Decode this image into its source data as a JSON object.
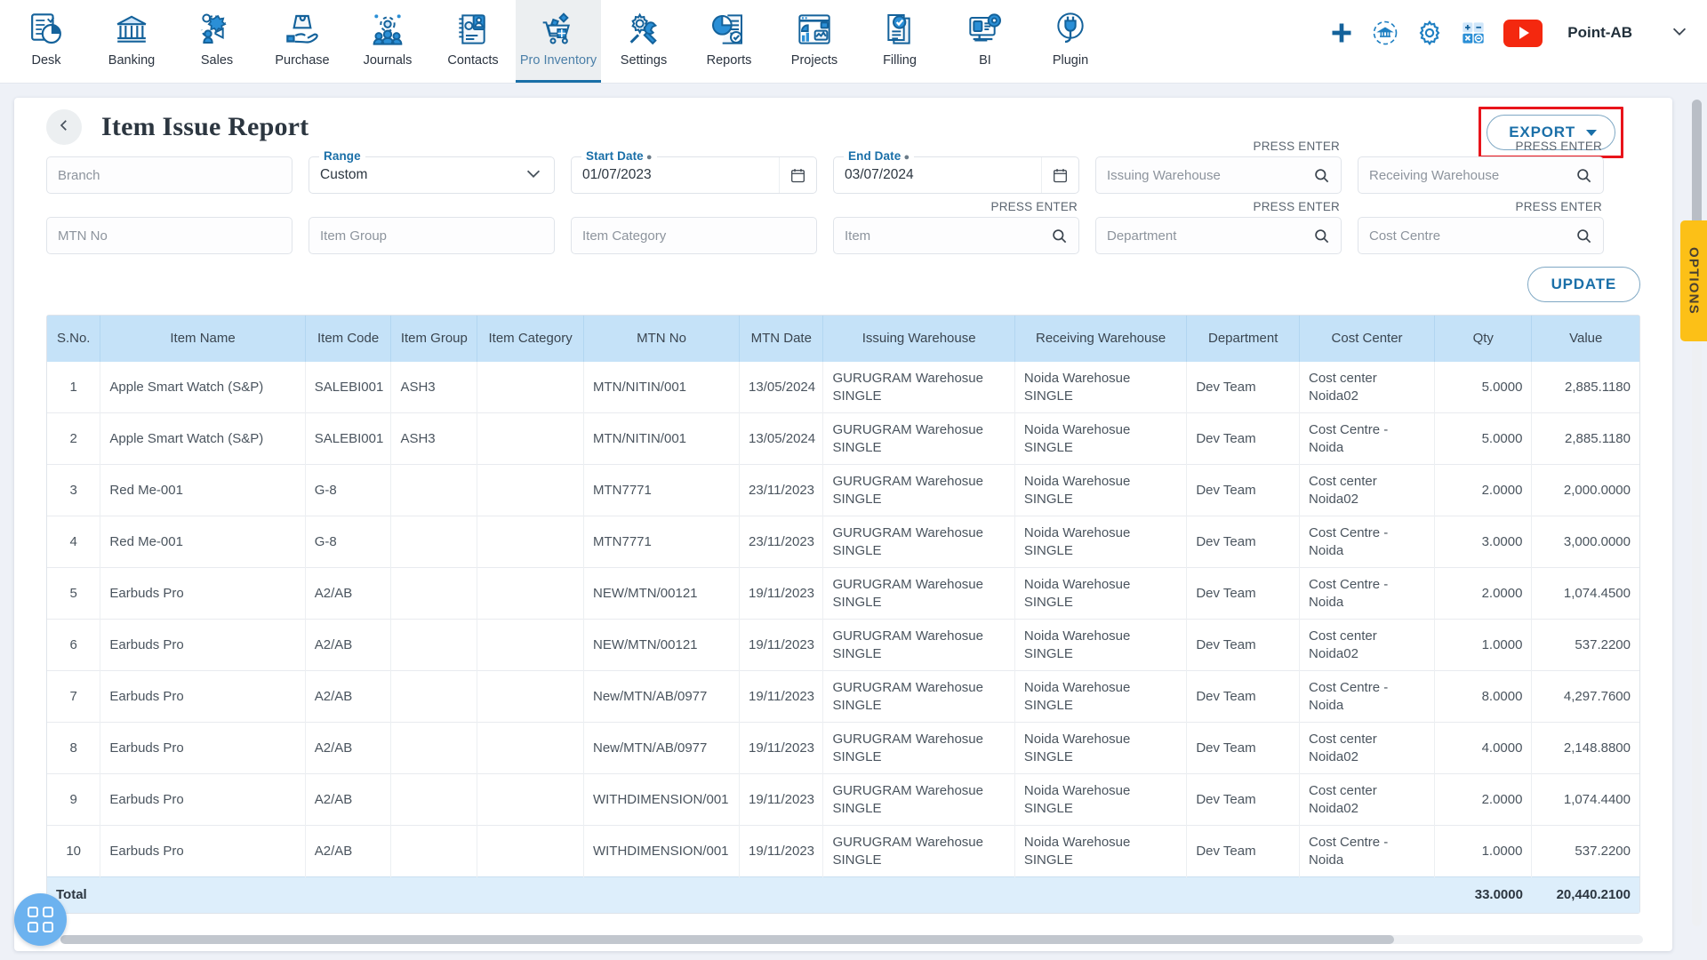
{
  "nav": {
    "items": [
      {
        "label": "Desk",
        "icon": "dashboard-icon",
        "active": false
      },
      {
        "label": "Banking",
        "icon": "bank-icon",
        "active": false
      },
      {
        "label": "Sales",
        "icon": "sales-icon",
        "active": false
      },
      {
        "label": "Purchase",
        "icon": "purchase-icon",
        "active": false
      },
      {
        "label": "Journals",
        "icon": "journals-icon",
        "active": false
      },
      {
        "label": "Contacts",
        "icon": "contacts-icon",
        "active": false
      },
      {
        "label": "Pro Inventory",
        "icon": "inventory-cart-icon",
        "active": true
      },
      {
        "label": "Settings",
        "icon": "settings-tools-icon",
        "active": false
      },
      {
        "label": "Reports",
        "icon": "reports-pie-icon",
        "active": false
      },
      {
        "label": "Projects",
        "icon": "projects-icon",
        "active": false
      },
      {
        "label": "Filling",
        "icon": "filling-check-icon",
        "active": false
      },
      {
        "label": "BI",
        "icon": "bi-monitor-icon",
        "active": false
      },
      {
        "label": "Plugin",
        "icon": "plugin-plug-icon",
        "active": false
      }
    ],
    "right": {
      "add_icon": "plus-icon",
      "sync_icon": "bank-sync-icon",
      "settings_icon": "gear-icon",
      "calculator_icon": "calculator-icon",
      "youtube_icon": "youtube-icon",
      "brand": "Point-AB",
      "chevron_icon": "chevron-down-icon"
    }
  },
  "header": {
    "back_icon": "chevron-left-icon",
    "title": "Item Issue Report",
    "export_label": "EXPORT",
    "export_caret_icon": "caret-down-icon",
    "highlight_color": "#e8141b"
  },
  "filters": {
    "press_enter": "PRESS ENTER",
    "row1": [
      {
        "name": "branch",
        "placeholder": "Branch",
        "value": "",
        "type": "text",
        "label": ""
      },
      {
        "name": "range",
        "placeholder": "",
        "value": "Custom",
        "type": "select",
        "label": "Range",
        "required": false
      },
      {
        "name": "start-date",
        "placeholder": "",
        "value": "01/07/2023",
        "type": "date",
        "label": "Start Date",
        "required": true
      },
      {
        "name": "end-date",
        "placeholder": "",
        "value": "03/07/2024",
        "type": "date",
        "label": "End Date",
        "required": true
      },
      {
        "name": "issuing-warehouse",
        "placeholder": "Issuing Warehouse",
        "value": "",
        "type": "search",
        "label": ""
      },
      {
        "name": "receiving-warehouse",
        "placeholder": "Receiving Warehouse",
        "value": "",
        "type": "search",
        "label": ""
      }
    ],
    "row2": [
      {
        "name": "mtn-no",
        "placeholder": "MTN No",
        "value": "",
        "type": "text",
        "label": ""
      },
      {
        "name": "item-group",
        "placeholder": "Item Group",
        "value": "",
        "type": "text",
        "label": ""
      },
      {
        "name": "item-category",
        "placeholder": "Item Category",
        "value": "",
        "type": "text",
        "label": ""
      },
      {
        "name": "item",
        "placeholder": "Item",
        "value": "",
        "type": "search",
        "label": ""
      },
      {
        "name": "department",
        "placeholder": "Department",
        "value": "",
        "type": "search",
        "label": ""
      },
      {
        "name": "cost-centre",
        "placeholder": "Cost Centre",
        "value": "",
        "type": "search",
        "label": ""
      }
    ],
    "update_label": "UPDATE"
  },
  "options_tab": {
    "label": "OPTIONS",
    "color": "#fcc017"
  },
  "table": {
    "columns": [
      "S.No.",
      "Item Name",
      "Item Code",
      "Item Group",
      "Item Category",
      "MTN No",
      "MTN Date",
      "Issuing Warehouse",
      "Receiving Warehouse",
      "Department",
      "Cost Center",
      "Qty",
      "Value"
    ],
    "rows": [
      [
        "1",
        "Apple Smart Watch (S&P)",
        "SALEBI001",
        "ASH3",
        "",
        "MTN/NITIN/001",
        "13/05/2024",
        "GURUGRAM Warehosue SINGLE",
        "Noida Warehosue SINGLE",
        "Dev Team",
        "Cost center Noida02",
        "5.0000",
        "2,885.1180"
      ],
      [
        "2",
        "Apple Smart Watch (S&P)",
        "SALEBI001",
        "ASH3",
        "",
        "MTN/NITIN/001",
        "13/05/2024",
        "GURUGRAM Warehosue SINGLE",
        "Noida Warehosue SINGLE",
        "Dev Team",
        "Cost Centre - Noida",
        "5.0000",
        "2,885.1180"
      ],
      [
        "3",
        "Red Me-001",
        "G-8",
        "",
        "",
        "MTN7771",
        "23/11/2023",
        "GURUGRAM Warehosue SINGLE",
        "Noida Warehosue SINGLE",
        "Dev Team",
        "Cost center Noida02",
        "2.0000",
        "2,000.0000"
      ],
      [
        "4",
        "Red Me-001",
        "G-8",
        "",
        "",
        "MTN7771",
        "23/11/2023",
        "GURUGRAM Warehosue SINGLE",
        "Noida Warehosue SINGLE",
        "Dev Team",
        "Cost Centre - Noida",
        "3.0000",
        "3,000.0000"
      ],
      [
        "5",
        "Earbuds Pro",
        "A2/AB",
        "",
        "",
        "NEW/MTN/00121",
        "19/11/2023",
        "GURUGRAM Warehosue SINGLE",
        "Noida Warehosue SINGLE",
        "Dev Team",
        "Cost Centre - Noida",
        "2.0000",
        "1,074.4500"
      ],
      [
        "6",
        "Earbuds Pro",
        "A2/AB",
        "",
        "",
        "NEW/MTN/00121",
        "19/11/2023",
        "GURUGRAM Warehosue SINGLE",
        "Noida Warehosue SINGLE",
        "Dev Team",
        "Cost center Noida02",
        "1.0000",
        "537.2200"
      ],
      [
        "7",
        "Earbuds Pro",
        "A2/AB",
        "",
        "",
        "New/MTN/AB/0977",
        "19/11/2023",
        "GURUGRAM Warehosue SINGLE",
        "Noida Warehosue SINGLE",
        "Dev Team",
        "Cost Centre - Noida",
        "8.0000",
        "4,297.7600"
      ],
      [
        "8",
        "Earbuds Pro",
        "A2/AB",
        "",
        "",
        "New/MTN/AB/0977",
        "19/11/2023",
        "GURUGRAM Warehosue SINGLE",
        "Noida Warehosue SINGLE",
        "Dev Team",
        "Cost center Noida02",
        "4.0000",
        "2,148.8800"
      ],
      [
        "9",
        "Earbuds Pro",
        "A2/AB",
        "",
        "",
        "WITHDIMENSION/001",
        "19/11/2023",
        "GURUGRAM Warehosue SINGLE",
        "Noida Warehosue SINGLE",
        "Dev Team",
        "Cost center Noida02",
        "2.0000",
        "1,074.4400"
      ],
      [
        "10",
        "Earbuds Pro",
        "A2/AB",
        "",
        "",
        "WITHDIMENSION/001",
        "19/11/2023",
        "GURUGRAM Warehosue SINGLE",
        "Noida Warehosue SINGLE",
        "Dev Team",
        "Cost Centre - Noida",
        "1.0000",
        "537.2200"
      ]
    ],
    "total": {
      "label": "Total",
      "qty": "33.0000",
      "value": "20,440.2100"
    }
  },
  "fab": {
    "icon": "grid-apps-icon"
  }
}
